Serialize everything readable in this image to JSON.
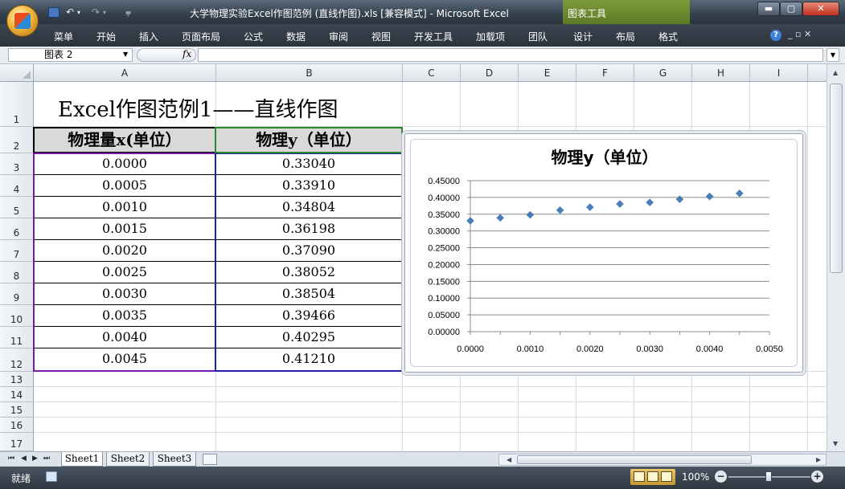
{
  "window": {
    "title": "大学物理实验Excel作图范例 (直线作图).xls  [兼容模式] - Microsoft Excel",
    "context_tab": "图表工具",
    "min_label": "▬",
    "max_label": "▢",
    "close_label": "✕"
  },
  "quick_access": {
    "undo_label": "↶",
    "redo_label": "↷",
    "customize_label": "⩦"
  },
  "ribbon": {
    "tabs": [
      "菜单",
      "开始",
      "插入",
      "页面布局",
      "公式",
      "数据",
      "审阅",
      "视图",
      "开发工具",
      "加载项",
      "团队",
      "设计",
      "布局",
      "格式"
    ],
    "help_label": "?",
    "extra_controls": "_   ▫   ✕"
  },
  "formula_bar": {
    "name_box": "图表 2",
    "fx_label": "fx",
    "formula": ""
  },
  "grid": {
    "columns": [
      "A",
      "B",
      "C",
      "D",
      "E",
      "F",
      "G",
      "H",
      "I"
    ],
    "rows": [
      "1",
      "2",
      "3",
      "4",
      "5",
      "6",
      "7",
      "8",
      "9",
      "10",
      "11",
      "12",
      "13",
      "14",
      "15",
      "16",
      "17"
    ]
  },
  "sheet": {
    "title": "Excel作图范例1——直线作图",
    "header_x": "物理量x(单位）",
    "header_y": "物理y（单位）",
    "x_values": [
      "0.0000",
      "0.0005",
      "0.0010",
      "0.0015",
      "0.0020",
      "0.0025",
      "0.0030",
      "0.0035",
      "0.0040",
      "0.0045"
    ],
    "y_values": [
      "0.33040",
      "0.33910",
      "0.34804",
      "0.36198",
      "0.37090",
      "0.38052",
      "0.38504",
      "0.39466",
      "0.40295",
      "0.41210"
    ]
  },
  "chart_data": {
    "type": "scatter",
    "title": "物理y（单位）",
    "xlabel": "",
    "ylabel": "",
    "x": [
      0.0,
      0.0005,
      0.001,
      0.0015,
      0.002,
      0.0025,
      0.003,
      0.0035,
      0.004,
      0.0045
    ],
    "y": [
      0.3304,
      0.3391,
      0.34804,
      0.36198,
      0.3709,
      0.38052,
      0.38504,
      0.39466,
      0.40295,
      0.4121
    ],
    "xlim": [
      0,
      0.005
    ],
    "ylim": [
      0,
      0.45
    ],
    "x_ticks": [
      "0.0000",
      "0.0010",
      "0.0020",
      "0.0030",
      "0.0040",
      "0.0050"
    ],
    "y_ticks": [
      "0.00000",
      "0.05000",
      "0.10000",
      "0.15000",
      "0.20000",
      "0.25000",
      "0.30000",
      "0.35000",
      "0.40000",
      "0.45000"
    ],
    "grid": true,
    "legend": "none",
    "marker": "diamond",
    "marker_color": "#4a7ebb"
  },
  "sheet_tabs": [
    "Sheet1",
    "Sheet2",
    "Sheet3"
  ],
  "tab_nav": [
    "⏮",
    "◀",
    "▶",
    "⏭"
  ],
  "status": {
    "text": "就绪",
    "zoom": "100%",
    "zoom_out": "−",
    "zoom_in": "+"
  },
  "colors": {
    "accent": "#4a7ebb",
    "header_fill": "#d9d9d9",
    "context_tab": "#6b8a2c"
  }
}
